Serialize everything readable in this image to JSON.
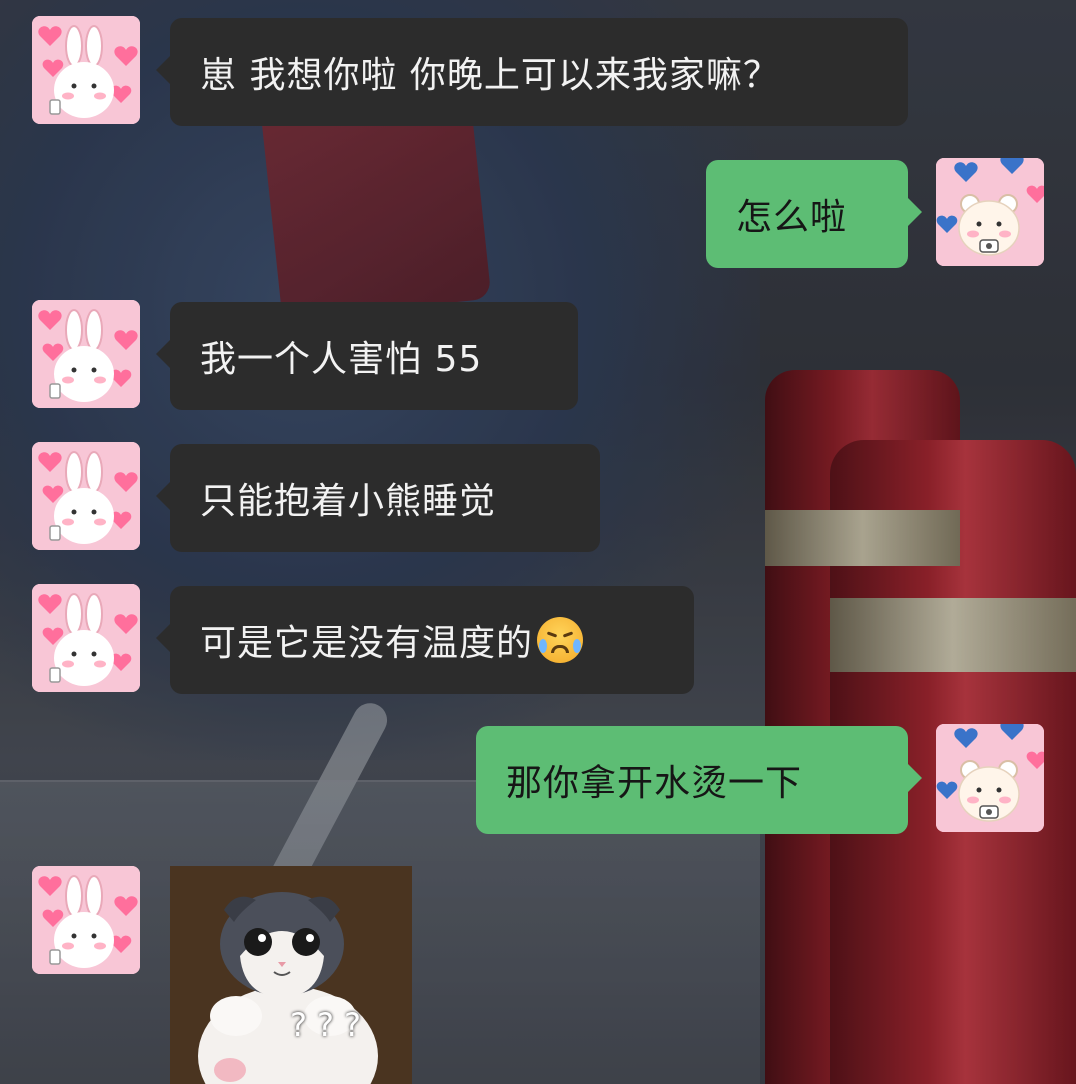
{
  "colors": {
    "bubble_incoming": "#2c2c2c",
    "bubble_outgoing": "#5dbd74",
    "avatar_bg": "#f8c6d6"
  },
  "contact": {
    "avatar_icon": "bunny-hearts-icon"
  },
  "me": {
    "avatar_icon": "bear-hearts-icon"
  },
  "messages": [
    {
      "from": "contact",
      "text": "崽 我想你啦 你晚上可以来我家嘛？"
    },
    {
      "from": "me",
      "text": "怎么啦"
    },
    {
      "from": "contact",
      "text": "我一个人害怕 55"
    },
    {
      "from": "contact",
      "text": "只能抱着小熊睡觉"
    },
    {
      "from": "contact",
      "text": "可是它是没有温度的",
      "emoji": "crying-laughing-emoji-icon"
    },
    {
      "from": "me",
      "text": "那你拿开水烫一下"
    },
    {
      "from": "contact",
      "type": "sticker",
      "sticker_icon": "surprised-cat-sticker-icon",
      "caption": "???"
    }
  ]
}
